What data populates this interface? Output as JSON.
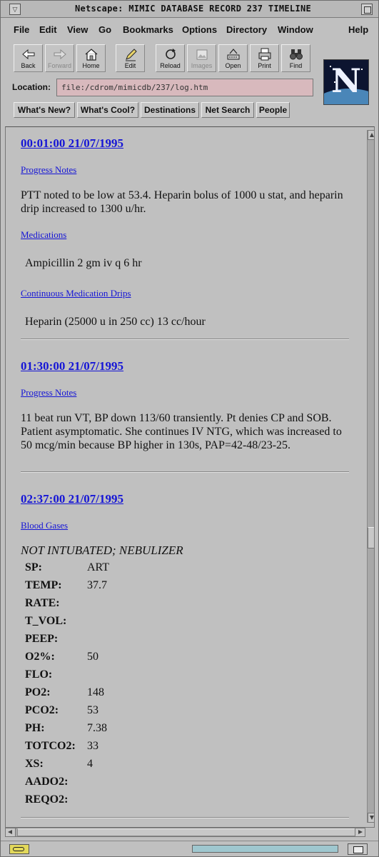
{
  "window": {
    "title": "Netscape: MIMIC DATABASE RECORD 237 TIMELINE"
  },
  "menu": [
    "File",
    "Edit",
    "View",
    "Go",
    "Bookmarks",
    "Options",
    "Directory",
    "Window",
    "Help"
  ],
  "toolbar": {
    "buttons": [
      {
        "label": "Back",
        "icon": "back-arrow-icon",
        "enabled": true
      },
      {
        "label": "Forward",
        "icon": "forward-arrow-icon",
        "enabled": false
      },
      {
        "label": "Home",
        "icon": "home-icon",
        "enabled": true
      },
      {
        "label": "Edit",
        "icon": "pencil-icon",
        "enabled": true
      },
      {
        "label": "Reload",
        "icon": "reload-icon",
        "enabled": true
      },
      {
        "label": "Images",
        "icon": "images-icon",
        "enabled": false
      },
      {
        "label": "Open",
        "icon": "open-icon",
        "enabled": true
      },
      {
        "label": "Print",
        "icon": "printer-icon",
        "enabled": true
      },
      {
        "label": "Find",
        "icon": "binoculars-icon",
        "enabled": true
      }
    ]
  },
  "location": {
    "label": "Location:",
    "value": "file:/cdrom/mimicdb/237/log.htm"
  },
  "directory_buttons": [
    "What's New?",
    "What's Cool?",
    "Destinations",
    "Net Search",
    "People"
  ],
  "entries": [
    {
      "timestamp": "00:01:00 21/07/1995",
      "progress_label": "Progress Notes",
      "progress_text": "PTT noted to be low at 53.4. Heparin bolus of 1000 u stat, and heparin drip increased to 1300 u/hr.",
      "medications_label": "Medications",
      "medication": "Ampicillin  2 gm  iv  q 6 hr",
      "drips_label": "Continuous Medication Drips",
      "drip": "Heparin (25000 u in 250 cc)   13 cc/hour"
    },
    {
      "timestamp": "01:30:00 21/07/1995",
      "progress_label": "Progress Notes",
      "progress_text": "11 beat run VT, BP down 113/60 transiently. Pt denies CP and SOB. Patient asymptomatic. She continues IV NTG, which was increased to 50 mcg/min because BP higher in 130s, PAP=42-48/23-25."
    },
    {
      "timestamp": "02:37:00 21/07/1995",
      "blood_gases_label": "Blood Gases",
      "heading": "NOT INTUBATED; NEBULIZER",
      "rows": [
        {
          "key": "SP:",
          "value": "ART"
        },
        {
          "key": "TEMP:",
          "value": "37.7"
        },
        {
          "key": "RATE:",
          "value": ""
        },
        {
          "key": "T_VOL:",
          "value": ""
        },
        {
          "key": "PEEP:",
          "value": ""
        },
        {
          "key": "O2%:",
          "value": "50"
        },
        {
          "key": "FLO:",
          "value": ""
        },
        {
          "key": "PO2:",
          "value": "148"
        },
        {
          "key": "PCO2:",
          "value": "53"
        },
        {
          "key": "PH:",
          "value": "7.38"
        },
        {
          "key": "TOTCO2:",
          "value": "33"
        },
        {
          "key": "XS:",
          "value": "4"
        },
        {
          "key": "AADO2:",
          "value": ""
        },
        {
          "key": "REQO2:",
          "value": ""
        }
      ]
    }
  ],
  "status": {
    "text": ""
  },
  "colors": {
    "link": "#1515d6",
    "chrome": "#c0c0c0",
    "location_bg": "#d8b9bd",
    "progress": "#9fc7cf"
  }
}
